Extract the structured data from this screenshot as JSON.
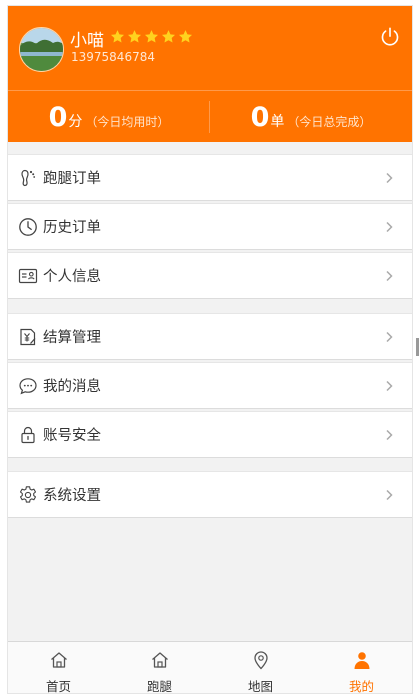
{
  "profile": {
    "name": "小喵",
    "phone": "13975846784",
    "rating_stars": 5,
    "icons": {
      "avatar": "avatar-landscape",
      "power": "power-icon",
      "star": "star-icon"
    }
  },
  "stats": [
    {
      "value": "0",
      "unit": "分",
      "note": "（今日均用时）"
    },
    {
      "value": "0",
      "unit": "单",
      "note": "（今日总完成）"
    }
  ],
  "menu_groups": [
    [
      {
        "label": "跑腿订单",
        "icon": "footprint-icon"
      },
      {
        "label": "历史订单",
        "icon": "clock-icon"
      },
      {
        "label": "个人信息",
        "icon": "id-card-icon"
      }
    ],
    [
      {
        "label": "结算管理",
        "icon": "yuan-document-icon"
      },
      {
        "label": "我的消息",
        "icon": "chat-bubble-icon"
      },
      {
        "label": "账号安全",
        "icon": "lock-icon"
      }
    ],
    [
      {
        "label": "系统设置",
        "icon": "gear-icon"
      }
    ]
  ],
  "tabbar": {
    "items": [
      {
        "label": "首页",
        "icon": "home-icon"
      },
      {
        "label": "跑腿",
        "icon": "home-icon"
      },
      {
        "label": "地图",
        "icon": "map-pin-icon"
      },
      {
        "label": "我的",
        "icon": "person-icon"
      }
    ],
    "active_index": 3
  },
  "colors": {
    "accent": "#ff7300",
    "star": "#ffd21e",
    "background": "#f2f2f2",
    "text": "#333333"
  }
}
